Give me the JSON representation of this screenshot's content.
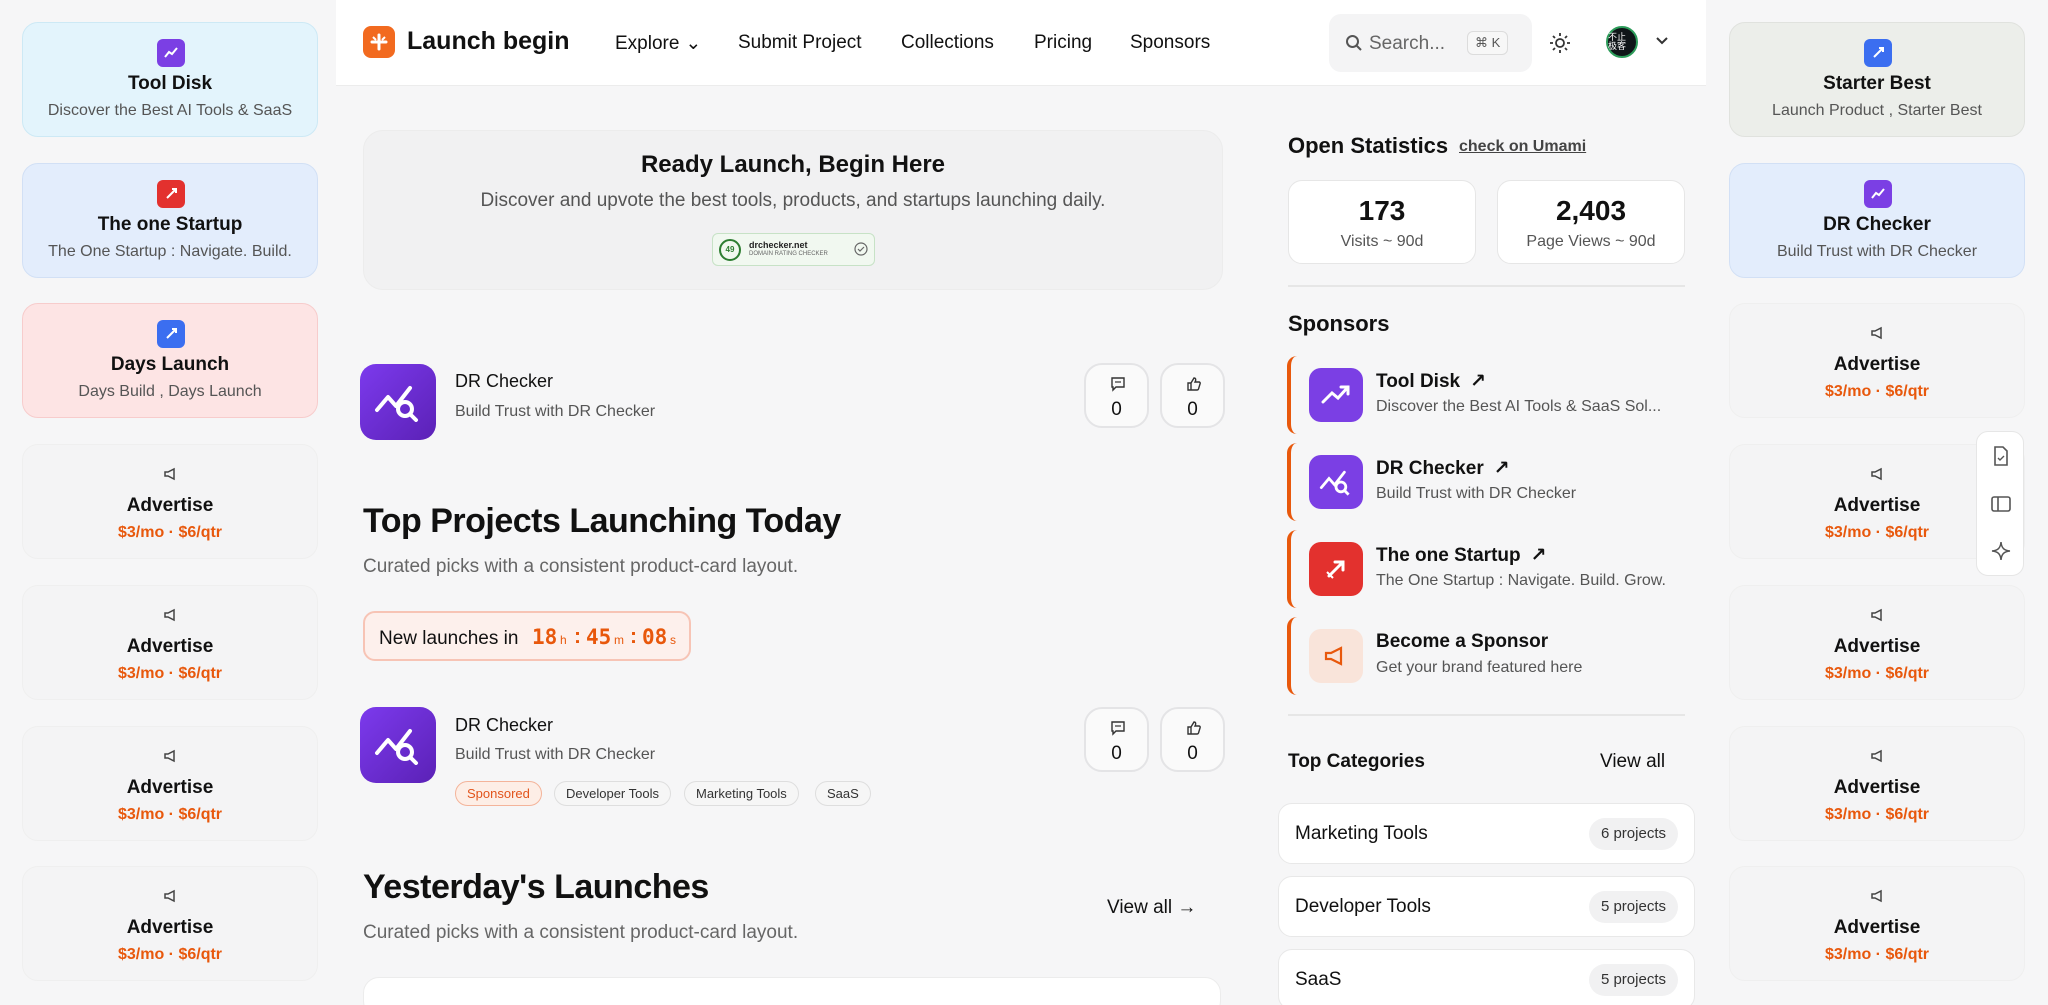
{
  "header": {
    "brand": "Launch begin",
    "nav": [
      "Explore",
      "Submit Project",
      "Collections",
      "Pricing",
      "Sponsors"
    ],
    "search_placeholder": "Search...",
    "search_shortcut": "⌘ K",
    "avatar_text": "不止 极客"
  },
  "left_cards": [
    {
      "title": "Tool Disk",
      "subtitle": "Discover the Best AI Tools & SaaS",
      "icon": "trending-up-icon",
      "bg": "#e3f4fc"
    },
    {
      "title": "The one Startup",
      "subtitle": "The One Startup : Navigate. Build.",
      "icon": "rocket-icon",
      "bg": "#e3edfc"
    },
    {
      "title": "Days Launch",
      "subtitle": "Days Build , Days Launch",
      "icon": "rocket-icon",
      "bg": "#fde4e4"
    }
  ],
  "right_cards": [
    {
      "title": "Starter Best",
      "subtitle": "Launch Product , Starter Best",
      "icon": "rocket-icon",
      "bg": "#eceeea"
    },
    {
      "title": "DR Checker",
      "subtitle": "Build Trust with DR Checker",
      "icon": "chart-search-icon",
      "bg": "#e3edfc"
    }
  ],
  "advertise": {
    "title": "Advertise",
    "price": "$3/mo · $6/qtr"
  },
  "hero": {
    "title": "Ready Launch, Begin Here",
    "subtitle": "Discover and upvote the best tools, products, and startups launching daily.",
    "badge_score": "49",
    "badge_site": "drchecker.net",
    "badge_caption": "DOMAIN RATING CHECKER"
  },
  "featured": {
    "name": "DR Checker",
    "desc": "Build Trust with DR Checker",
    "comments": "0",
    "upvotes": "0"
  },
  "top_projects": {
    "title": "Top Projects Launching Today",
    "subtitle": "Curated picks with a consistent product-card layout.",
    "countdown_label": "New launches in",
    "hours": "18",
    "minutes": "45",
    "seconds": "08",
    "h_unit": "h",
    "m_unit": "m",
    "s_unit": "s",
    "product": {
      "name": "DR Checker",
      "desc": "Build Trust with DR Checker",
      "comments": "0",
      "upvotes": "0",
      "tags": [
        "Sponsored",
        "Developer Tools",
        "Marketing Tools",
        "SaaS"
      ]
    }
  },
  "yesterday": {
    "title": "Yesterday's Launches",
    "subtitle": "Curated picks with a consistent product-card layout.",
    "view_all": "View all"
  },
  "stats": {
    "title": "Open Statistics",
    "link": "check on Umami",
    "visits_value": "173",
    "visits_label": "Visits ~ 90d",
    "views_value": "2,403",
    "views_label": "Page Views ~ 90d"
  },
  "sponsors": {
    "title": "Sponsors",
    "items": [
      {
        "name": "Tool Disk",
        "desc": "Discover the Best AI Tools & SaaS Sol...",
        "color": "#7b3fe4"
      },
      {
        "name": "DR Checker",
        "desc": "Build Trust with DR Checker",
        "color": "#7b3fe4"
      },
      {
        "name": "The one Startup",
        "desc": "The One Startup : Navigate. Build. Grow.",
        "color": "#e3312e"
      },
      {
        "name": "Become a Sponsor",
        "desc": "Get your brand featured here",
        "color": "#f9e4da"
      }
    ]
  },
  "categories": {
    "title": "Top Categories",
    "view_all": "View all",
    "items": [
      {
        "name": "Marketing Tools",
        "count": "6 projects"
      },
      {
        "name": "Developer Tools",
        "count": "5 projects"
      },
      {
        "name": "SaaS",
        "count": "5 projects"
      }
    ]
  }
}
